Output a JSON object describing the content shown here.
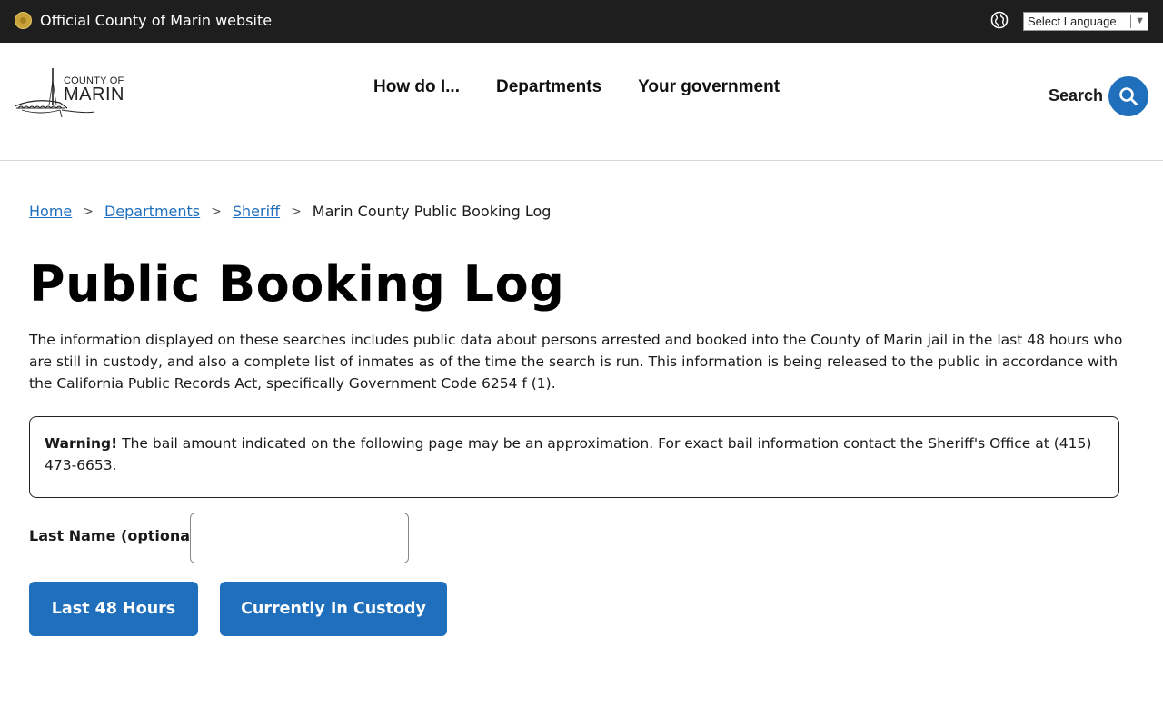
{
  "official_bar": {
    "text": "Official County of Marin website",
    "language_select": "Select Language",
    "language_arrow": "▼"
  },
  "logo": {
    "line1": "COUNTY OF",
    "line2": "MARIN"
  },
  "nav": {
    "items": [
      {
        "label": "How do I..."
      },
      {
        "label": "Departments"
      },
      {
        "label": "Your government"
      }
    ]
  },
  "search": {
    "label": "Search"
  },
  "breadcrumb": {
    "home": "Home",
    "departments": "Departments",
    "sheriff": "Sheriff",
    "current": "Marin County Public Booking Log",
    "separator": ">"
  },
  "page": {
    "title": "Public Booking Log",
    "intro": "The information displayed on these searches includes public data about persons arrested and booked into the County of Marin jail in the last 48 hours who are still in custody, and also a complete list of inmates as of the time the search is run. This information is being released to the public in accordance with the California Public Records Act, specifically Government Code 6254 f (1).",
    "warning_strong": "Warning!",
    "warning_text": " The bail amount indicated on the following page may be an approximation. For exact bail information contact the Sheriff's Office at (415) 473-6653."
  },
  "form": {
    "lastname_label": "Last Name (optional):",
    "lastname_value": "",
    "buttons": {
      "last48": "Last 48 Hours",
      "custody": "Currently In Custody"
    }
  },
  "colors": {
    "accent": "#1f6fbd",
    "topbar": "#1e1e1e"
  }
}
